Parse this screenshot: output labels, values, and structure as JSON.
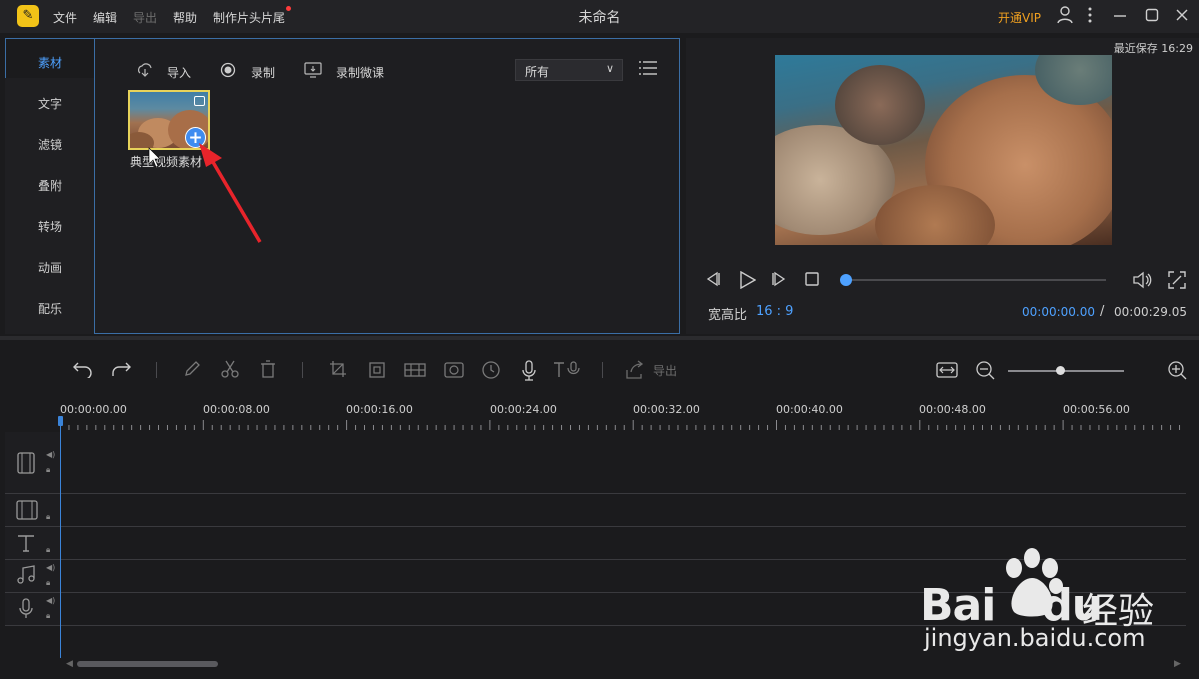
{
  "window": {
    "title": "未命名",
    "menu": [
      {
        "label": "文件",
        "enabled": true
      },
      {
        "label": "编辑",
        "enabled": true
      },
      {
        "label": "导出",
        "enabled": false
      },
      {
        "label": "帮助",
        "enabled": true
      },
      {
        "label": "制作片头片尾",
        "enabled": true
      }
    ],
    "vip_label": "开通VIP",
    "accent": "#4ea1ff",
    "vip_color": "#f0a020"
  },
  "sidebar": {
    "items": [
      {
        "label": "素材",
        "active": true
      },
      {
        "label": "文字"
      },
      {
        "label": "滤镜"
      },
      {
        "label": "叠附"
      },
      {
        "label": "转场"
      },
      {
        "label": "动画"
      },
      {
        "label": "配乐"
      }
    ]
  },
  "media": {
    "import_label": "导入",
    "record_label": "录制",
    "microcourse_label": "录制微课",
    "filter_selected": "所有",
    "clip_label": "典型视频素材"
  },
  "preview": {
    "last_saved": "最近保存 16:29",
    "aspect_label": "宽高比",
    "aspect_value": "16 : 9",
    "current_time": "00:00:00.00",
    "time_separator": "/",
    "duration": "00:00:29.05",
    "progress": 0
  },
  "toolbar": {
    "export_label": "导出",
    "zoom_level": 0.45
  },
  "timeline": {
    "ruler": [
      "00:00:00.00",
      "00:00:08.00",
      "00:00:16.00",
      "00:00:24.00",
      "00:00:32.00",
      "00:00:40.00",
      "00:00:48.00",
      "00:00:56.00"
    ]
  },
  "watermark": {
    "brand": "Bai",
    "brand2": "du",
    "cn": "经验",
    "url": "jingyan.baidu.com"
  }
}
